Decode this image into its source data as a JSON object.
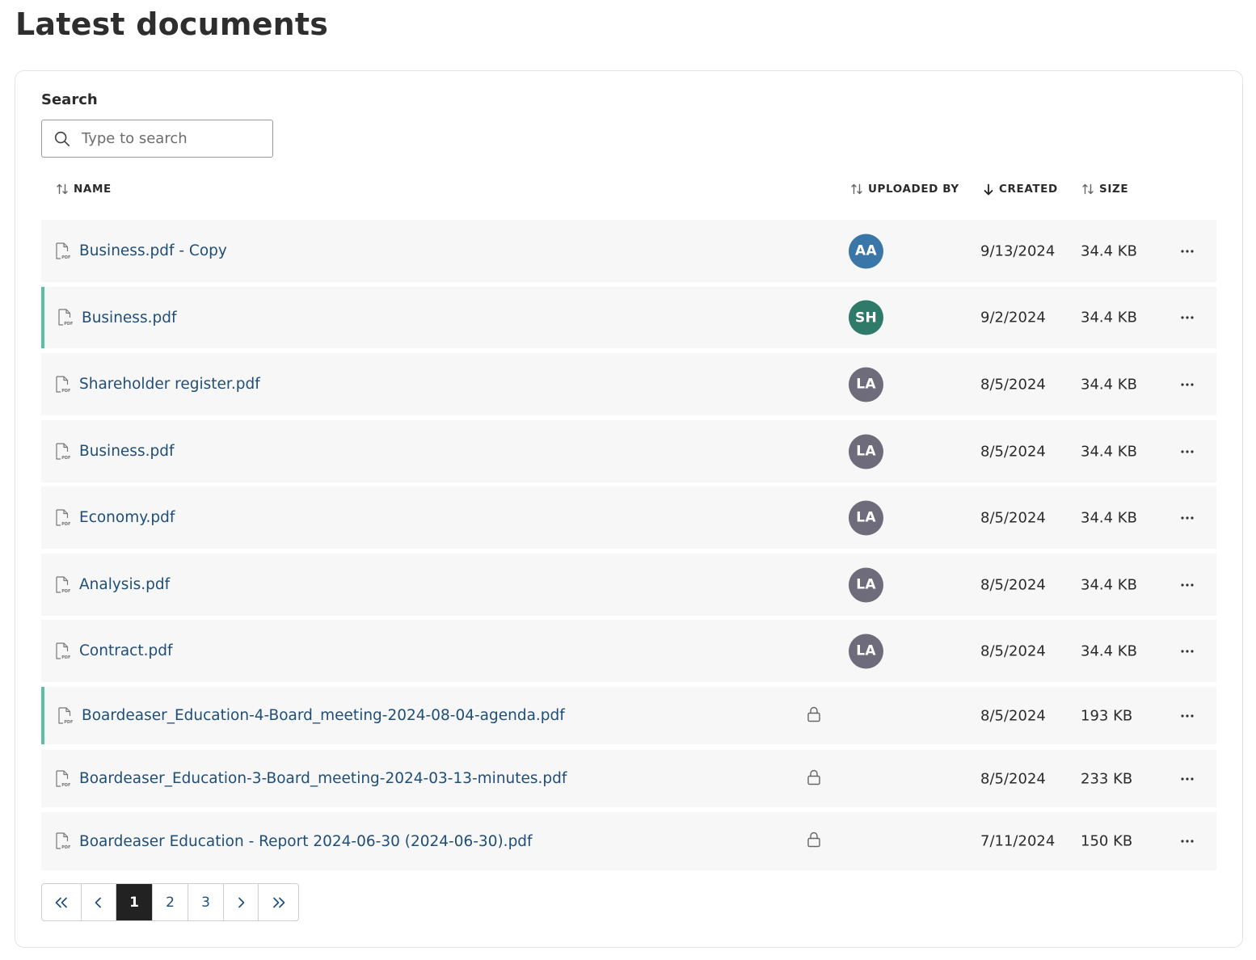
{
  "page_title": "Latest documents",
  "search": {
    "label": "Search",
    "placeholder": "Type to search"
  },
  "columns": {
    "name": "NAME",
    "uploaded_by": "UPLOADED BY",
    "created": "CREATED",
    "size": "SIZE"
  },
  "sort": {
    "active_column": "created",
    "direction": "descending"
  },
  "rows": [
    {
      "name": "Business.pdf - Copy",
      "uploader": "AA",
      "uploader_color": "#3a77a8",
      "created": "9/13/2024",
      "size": "34.4 KB",
      "locked": false,
      "marked": false
    },
    {
      "name": "Business.pdf",
      "uploader": "SH",
      "uploader_color": "#2f7a68",
      "created": "9/2/2024",
      "size": "34.4 KB",
      "locked": false,
      "marked": true
    },
    {
      "name": "Shareholder register.pdf",
      "uploader": "LA",
      "uploader_color": "#6e6c7a",
      "created": "8/5/2024",
      "size": "34.4 KB",
      "locked": false,
      "marked": false
    },
    {
      "name": "Business.pdf",
      "uploader": "LA",
      "uploader_color": "#6e6c7a",
      "created": "8/5/2024",
      "size": "34.4 KB",
      "locked": false,
      "marked": false
    },
    {
      "name": "Economy.pdf",
      "uploader": "LA",
      "uploader_color": "#6e6c7a",
      "created": "8/5/2024",
      "size": "34.4 KB",
      "locked": false,
      "marked": false
    },
    {
      "name": "Analysis.pdf",
      "uploader": "LA",
      "uploader_color": "#6e6c7a",
      "created": "8/5/2024",
      "size": "34.4 KB",
      "locked": false,
      "marked": false
    },
    {
      "name": "Contract.pdf",
      "uploader": "LA",
      "uploader_color": "#6e6c7a",
      "created": "8/5/2024",
      "size": "34.4 KB",
      "locked": false,
      "marked": false
    },
    {
      "name": "Boardeaser_Education-4-Board_meeting-2024-08-04-agenda.pdf",
      "uploader": "",
      "uploader_color": "",
      "created": "8/5/2024",
      "size": "193 KB",
      "locked": true,
      "marked": true
    },
    {
      "name": "Boardeaser_Education-3-Board_meeting-2024-03-13-minutes.pdf",
      "uploader": "",
      "uploader_color": "",
      "created": "8/5/2024",
      "size": "233 KB",
      "locked": true,
      "marked": false
    },
    {
      "name": "Boardeaser Education - Report 2024-06-30 (2024-06-30).pdf",
      "uploader": "",
      "uploader_color": "",
      "created": "7/11/2024",
      "size": "150 KB",
      "locked": true,
      "marked": false
    }
  ],
  "pagination": {
    "pages": [
      "1",
      "2",
      "3"
    ],
    "current": "1",
    "icons": [
      "first-page-icon",
      "prev-page-icon",
      "next-page-icon",
      "last-page-icon"
    ]
  },
  "colors": {
    "link": "#1f4e79",
    "marker": "#5bbfa6",
    "row_bg": "#f7f7f7",
    "active_page": "#222222"
  }
}
